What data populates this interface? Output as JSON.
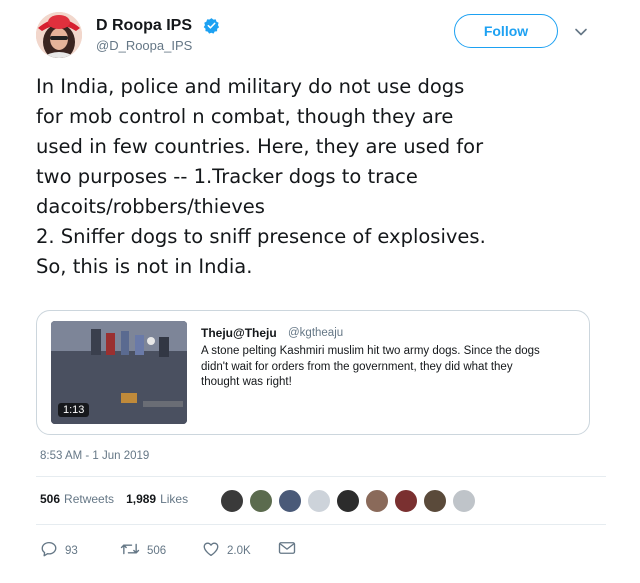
{
  "author": {
    "name": "D Roopa IPS",
    "handle": "@D_Roopa_IPS",
    "follow_label": "Follow"
  },
  "tweet": {
    "lines": [
      "In India, police and  military do not use dogs",
      "for mob control n combat, though they are",
      "used in few countries. Here, they are used for",
      "two purposes -- 1.Tracker dogs to trace",
      "dacoits/robbers/thieves",
      "2. Sniffer dogs to sniff presence of explosives.",
      "So, this is not in India."
    ]
  },
  "quoted_tweet": {
    "author": "Theju@Theju",
    "handle": "@kgtheaju",
    "video_duration": "1:13",
    "lines": [
      "A stone pelting Kashmiri muslim hit two army dogs. Since the dogs",
      "didn't wait for orders from the government, they did what they",
      "thought was right!"
    ]
  },
  "timestamp": "8:53 AM - 1 Jun 2019",
  "stats": {
    "retweets_count": "506",
    "retweets_label": "Retweets",
    "likes_count": "1,989",
    "likes_label": "Likes"
  },
  "actions": {
    "replies": "93",
    "retweets": "506",
    "likes": "2.0K"
  },
  "colors": {
    "accent": "#1da1f2",
    "secondary_text": "#657786",
    "border": "#ccd6dd"
  },
  "icons": [
    "verified-icon",
    "chevron-down-icon",
    "reply-icon",
    "retweet-icon",
    "like-icon",
    "message-icon"
  ]
}
